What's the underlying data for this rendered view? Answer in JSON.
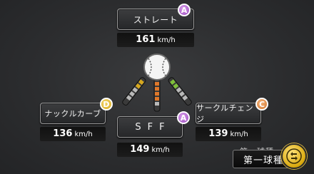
{
  "pitches": {
    "straight": {
      "label": "ストレート",
      "speed": "161",
      "unit": "km/h",
      "grade": "A"
    },
    "knuckle": {
      "label": "ナックルカーブ",
      "speed": "136",
      "unit": "km/h",
      "grade": "D"
    },
    "circle": {
      "label": "サークルチェンジ",
      "speed": "139",
      "unit": "km/h",
      "grade": "C"
    },
    "sff": {
      "label": "SFF",
      "speed": "149",
      "unit": "km/h",
      "grade": "A"
    }
  },
  "first_pitch": {
    "label": "第一球種",
    "shadow_label": "第一球種"
  },
  "icons": {
    "ball": "baseball-icon",
    "switch": "cycle-icon"
  },
  "colors": {
    "grade_a": "#9b4cc0",
    "grade_c": "#d2772f",
    "grade_d": "#d7a91f",
    "accent": "#d9a90e"
  }
}
